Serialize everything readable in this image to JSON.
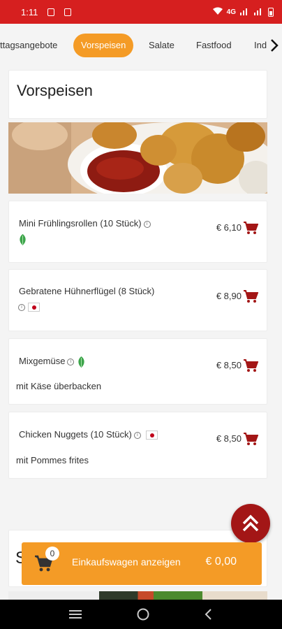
{
  "status_bar": {
    "time": "1:11",
    "network_label": "4G",
    "accent_color": "#d61f1f"
  },
  "categories": {
    "tabs": [
      {
        "label": "ttagsangebote"
      },
      {
        "label": "Vorspeisen",
        "active": true
      },
      {
        "label": "Salate"
      },
      {
        "label": "Fastfood"
      },
      {
        "label": "Ind"
      }
    ],
    "active_color": "#f49b26"
  },
  "section": {
    "title": "Vorspeisen"
  },
  "items": [
    {
      "name": "Mini Frühlingsrollen (10 Stück)",
      "price": "€ 6,10",
      "description": "",
      "badges": [
        "info",
        "vegetarian-leaf"
      ]
    },
    {
      "name": "Gebratene Hühnerflügel (8 Stück)",
      "price": "€ 8,90",
      "description": "",
      "badges": [
        "info",
        "japan-flag"
      ]
    },
    {
      "name": "Mixgemüse",
      "price": "€ 8,50",
      "description": "mit Käse überbacken",
      "badges": [
        "info",
        "vegetarian-leaf"
      ]
    },
    {
      "name": "Chicken Nuggets (10 Stück)",
      "price": "€ 8,50",
      "description": "mit Pommes frites",
      "badges": [
        "info",
        "japan-flag"
      ]
    }
  ],
  "next_section": {
    "title_visible": "S"
  },
  "cart": {
    "count": "0",
    "label": "Einkaufswagen anzeigen",
    "total": "€ 0,00"
  },
  "colors": {
    "brand_red": "#a31616",
    "brand_orange": "#f49b26"
  }
}
